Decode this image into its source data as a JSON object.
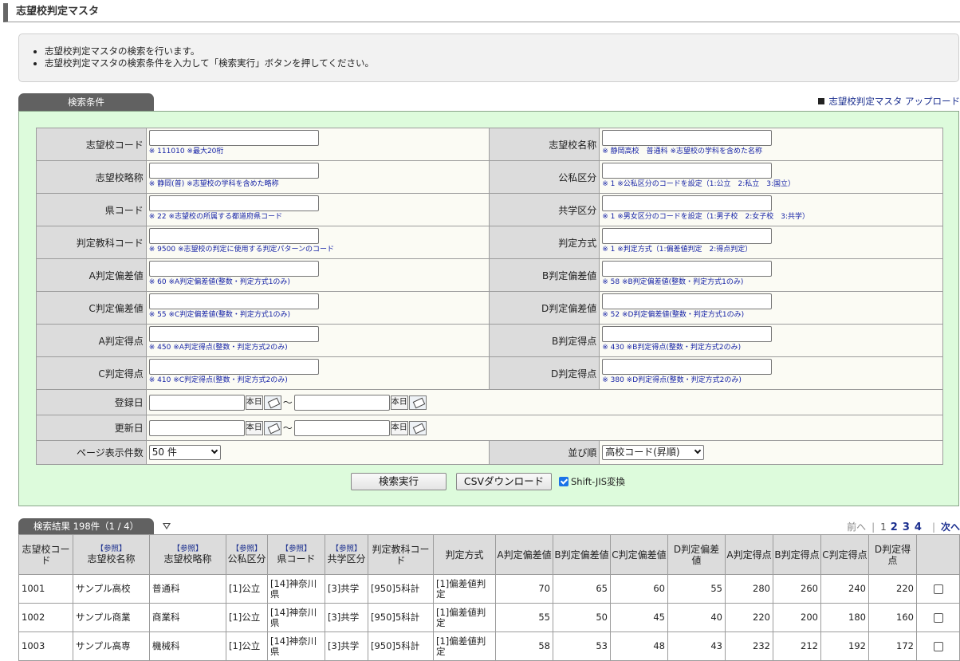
{
  "page_title": "志望校判定マスタ",
  "info": [
    "志望校判定マスタの検索を行います。",
    "志望校判定マスタの検索条件を入力して「検索実行」ボタンを押してください。"
  ],
  "search_tab": "検索条件",
  "upload_link": "志望校判定マスタ アップロード",
  "form": {
    "school_code": {
      "label": "志望校コード",
      "value": "",
      "hint": "※ 111010 ※最大20桁"
    },
    "school_name": {
      "label": "志望校名称",
      "value": "",
      "hint": "※ 静岡高校　普通科 ※志望校の学科を含めた名称"
    },
    "school_abbr": {
      "label": "志望校略称",
      "value": "",
      "hint": "※ 静岡(普) ※志望校の学科を含めた略称"
    },
    "public_private": {
      "label": "公私区分",
      "value": "",
      "hint": "※ 1 ※公私区分のコードを設定（1:公立　2:私立　3:国立）"
    },
    "pref_code": {
      "label": "県コード",
      "value": "",
      "hint": "※ 22 ※志望校の所属する都道府県コード"
    },
    "coed": {
      "label": "共学区分",
      "value": "",
      "hint": "※ 1 ※男女区分のコードを設定（1:男子校　2:女子校　3:共学）"
    },
    "subject_code": {
      "label": "判定教科コード",
      "value": "",
      "hint": "※ 9500 ※志望校の判定に使用する判定パターンのコード"
    },
    "method": {
      "label": "判定方式",
      "value": "",
      "hint": "※ 1 ※判定方式（1:偏差値判定　2:得点判定）"
    },
    "a_dev": {
      "label": "A判定偏差値",
      "value": "",
      "hint": "※ 60 ※A判定偏差値(整数・判定方式1のみ)"
    },
    "b_dev": {
      "label": "B判定偏差値",
      "value": "",
      "hint": "※ 58 ※B判定偏差値(整数・判定方式1のみ)"
    },
    "c_dev": {
      "label": "C判定偏差値",
      "value": "",
      "hint": "※ 55 ※C判定偏差値(整数・判定方式1のみ)"
    },
    "d_dev": {
      "label": "D判定偏差値",
      "value": "",
      "hint": "※ 52 ※D判定偏差値(整数・判定方式1のみ)"
    },
    "a_score": {
      "label": "A判定得点",
      "value": "",
      "hint": "※ 450 ※A判定得点(整数・判定方式2のみ)"
    },
    "b_score": {
      "label": "B判定得点",
      "value": "",
      "hint": "※ 430 ※B判定得点(整数・判定方式2のみ)"
    },
    "c_score": {
      "label": "C判定得点",
      "value": "",
      "hint": "※ 410 ※C判定得点(整数・判定方式2のみ)"
    },
    "d_score": {
      "label": "D判定得点",
      "value": "",
      "hint": "※ 380 ※D判定得点(整数・判定方式2のみ)"
    },
    "reg_date": {
      "label": "登録日"
    },
    "upd_date": {
      "label": "更新日"
    },
    "today_label": "本日",
    "tilde": "～",
    "page_size": {
      "label": "ページ表示件数",
      "value": "50 件"
    },
    "sort": {
      "label": "並び順",
      "value": "高校コード(昇順)"
    }
  },
  "buttons": {
    "search": "検索実行",
    "csv": "CSVダウンロード",
    "sjis": "Shift-JIS変換",
    "sjis_checked": true
  },
  "result_tab": "検索結果 198件（1 / 4）",
  "pager": {
    "prev": "前へ",
    "sep": "|",
    "current": "1",
    "pages": [
      "2",
      "3",
      "4"
    ],
    "next": "次へ"
  },
  "table": {
    "ref": "【参照】",
    "headers": [
      "志望校コード",
      "志望校名称",
      "志望校略称",
      "公私区分",
      "県コード",
      "共学区分",
      "判定教科コード",
      "判定方式",
      "A判定偏差値",
      "B判定偏差値",
      "C判定偏差値",
      "D判定偏差値",
      "A判定得点",
      "B判定得点",
      "C判定得点",
      "D判定得点"
    ],
    "rows": [
      {
        "code": "1001",
        "name": "サンプル高校",
        "abbr": "普通科",
        "pp": "[1]公立",
        "pref": "[14]神奈川県",
        "coed": "[3]共学",
        "subj": "[950]5科計",
        "method": "[1]偏差値判定",
        "a_dev": "70",
        "b_dev": "65",
        "c_dev": "60",
        "d_dev": "55",
        "a_sc": "280",
        "b_sc": "260",
        "c_sc": "240",
        "d_sc": "220"
      },
      {
        "code": "1002",
        "name": "サンプル商業",
        "abbr": "商業科",
        "pp": "[1]公立",
        "pref": "[14]神奈川県",
        "coed": "[3]共学",
        "subj": "[950]5科計",
        "method": "[1]偏差値判定",
        "a_dev": "55",
        "b_dev": "50",
        "c_dev": "45",
        "d_dev": "40",
        "a_sc": "220",
        "b_sc": "200",
        "c_sc": "180",
        "d_sc": "160"
      },
      {
        "code": "1003",
        "name": "サンプル高専",
        "abbr": "機械科",
        "pp": "[1]公立",
        "pref": "[14]神奈川県",
        "coed": "[3]共学",
        "subj": "[950]5科計",
        "method": "[1]偏差値判定",
        "a_dev": "58",
        "b_dev": "53",
        "c_dev": "48",
        "d_dev": "43",
        "a_sc": "232",
        "b_sc": "212",
        "c_sc": "192",
        "d_sc": "172"
      }
    ]
  }
}
